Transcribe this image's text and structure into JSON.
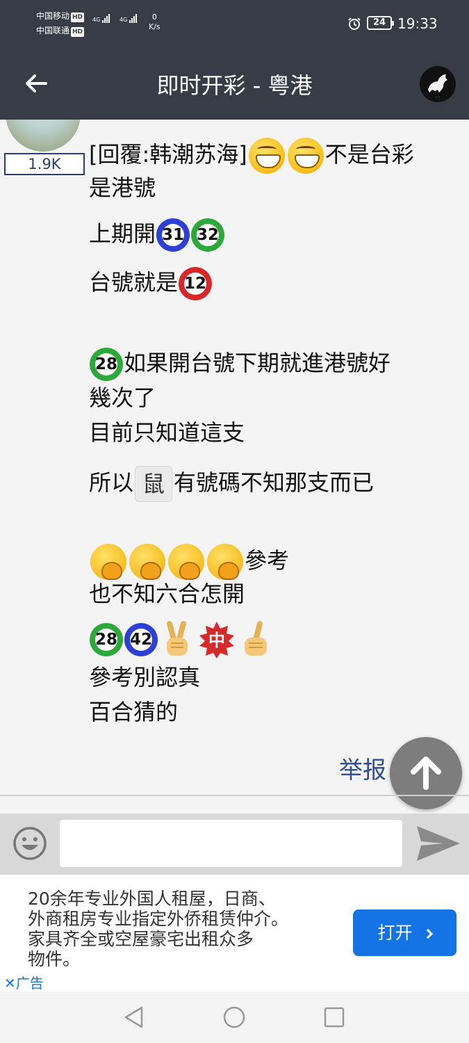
{
  "status_bar": {
    "carrier1": "中国移动",
    "carrier2": "中国联通",
    "hd": "HD",
    "net1": "4G",
    "net2": "4G",
    "speed_value": "0",
    "speed_unit": "K/s",
    "battery": "24",
    "time": "19:33"
  },
  "app_bar": {
    "title": "即时开彩 - 粤港"
  },
  "post": {
    "view_count": "1.9K",
    "line1_a": "[回覆:韩潮苏海]",
    "line1_b": "不是台彩",
    "line2": "是港號",
    "line3_a": "上期開",
    "ball_31": "31",
    "ball_32": "32",
    "line4_a": "台號就是",
    "ball_12": "12",
    "ball_28a": "28",
    "line5_b": "如果開台號下期就進港號好",
    "line6": "幾次了",
    "line7": "目前只知道這支",
    "line8_a": "所以",
    "rat": "鼠",
    "line8_b": "有號碼不知那支而已",
    "line9_b": "參考",
    "line10": "也不知六合怎開",
    "ball_28b": "28",
    "ball_42": "42",
    "zhong": "中",
    "line12": "參考別認真",
    "line13": "百合猜的",
    "report": "举报"
  },
  "ad": {
    "text": "20余年专业外国人租屋，日商、\n外商租房专业指定外侨租赁仲介。\n家具齐全或空屋豪宅出租众多\n物件。",
    "button": "打开",
    "tag": "广告"
  },
  "colors": {
    "bar": "#373c47",
    "ball_blue": "#2d3fd7",
    "ball_green": "#2da93a",
    "ball_red": "#d6282a",
    "link": "#2f4d8f",
    "ad_button": "#1574e5"
  }
}
